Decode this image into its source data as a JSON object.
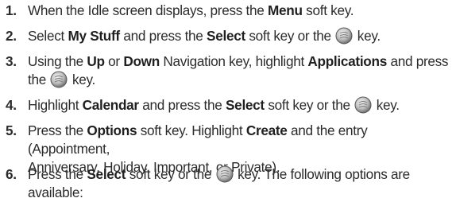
{
  "steps": [
    {
      "num": "1.",
      "parts": [
        {
          "t": "When the Idle screen displays, press the "
        },
        {
          "b": "Menu"
        },
        {
          "t": " soft key."
        }
      ]
    },
    {
      "num": "2.",
      "parts": [
        {
          "t": "Select "
        },
        {
          "b": "My Stuff"
        },
        {
          "t": " and press the "
        },
        {
          "b": "Select"
        },
        {
          "t": " soft key or the "
        },
        {
          "icon": "ok-key-icon"
        },
        {
          "t": " key."
        }
      ]
    },
    {
      "num": "3.",
      "parts": [
        {
          "t": "Using the "
        },
        {
          "b": "Up"
        },
        {
          "t": " or "
        },
        {
          "b": "Down"
        },
        {
          "t": " Navigation key, highlight "
        },
        {
          "b": "Applications"
        },
        {
          "t": " and press"
        },
        {
          "br": true
        },
        {
          "t": "the "
        },
        {
          "icon": "ok-key-icon"
        },
        {
          "t": " key."
        }
      ]
    },
    {
      "num": "4.",
      "parts": [
        {
          "t": "Highlight "
        },
        {
          "b": "Calendar"
        },
        {
          "t": " and press the "
        },
        {
          "b": "Select"
        },
        {
          "t": " soft key or the "
        },
        {
          "icon": "ok-key-icon"
        },
        {
          "t": " key."
        }
      ]
    },
    {
      "num": "5.",
      "parts": [
        {
          "t": "Press the "
        },
        {
          "b": "Options"
        },
        {
          "t": " soft key. Highlight "
        },
        {
          "b": "Create"
        },
        {
          "t": " and the entry (Appointment,"
        },
        {
          "br": true
        },
        {
          "t": "Anniversary, Holiday, Important, or Private)."
        }
      ]
    },
    {
      "num": "6.",
      "parts": [
        {
          "t": "Press the "
        },
        {
          "b": "Select"
        },
        {
          "t": " soft key or the "
        },
        {
          "icon": "ok-key-icon"
        },
        {
          "t": " key. The following options are"
        },
        {
          "br": true
        },
        {
          "t": "available:"
        }
      ]
    }
  ]
}
